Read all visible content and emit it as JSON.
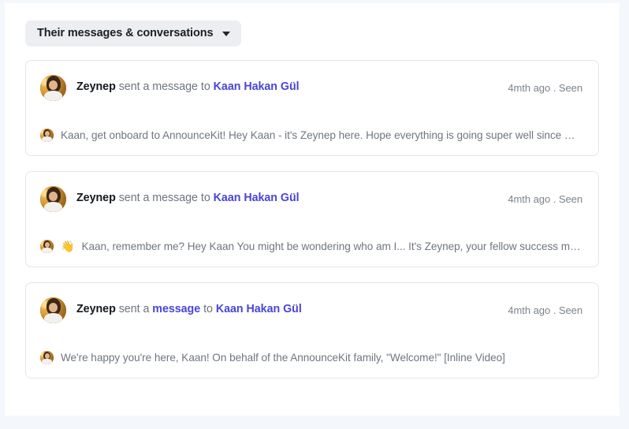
{
  "filter": {
    "label": "Their messages & conversations",
    "caret_icon": "chevron-down-icon"
  },
  "colors": {
    "page_background": "#f4f7fb",
    "panel_background": "#ffffff",
    "card_border": "#e2e5ea",
    "link": "#4a45d8",
    "muted_text": "#6d7480",
    "strong_text": "#14181d",
    "filter_button_background": "#eceef1"
  },
  "cards": [
    {
      "avatar_icon": "user-avatar-zeynep",
      "actor": "Zeynep",
      "action_prefix": "sent a",
      "action_word": "message",
      "action_word_is_link": false,
      "to_word": "to",
      "recipient": "Kaan Hakan Gül",
      "meta": "4mth ago . Seen",
      "preview_avatar_icon": "user-avatar-zeynep-small",
      "preview_emoji": "",
      "preview_text": "Kaan, get onboard to AnnounceKit! Hey Kaan - it's Zeynep here. Hope everything is going super well since my…"
    },
    {
      "avatar_icon": "user-avatar-zeynep",
      "actor": "Zeynep",
      "action_prefix": "sent a",
      "action_word": "message",
      "action_word_is_link": false,
      "to_word": "to",
      "recipient": "Kaan Hakan Gül",
      "meta": "4mth ago . Seen",
      "preview_avatar_icon": "user-avatar-zeynep-small",
      "preview_emoji": "👋",
      "preview_text": "Kaan, remember me? Hey Kaan You might be wondering who am I... It's Zeynep, your fellow success mana…"
    },
    {
      "avatar_icon": "user-avatar-zeynep",
      "actor": "Zeynep",
      "action_prefix": "sent a",
      "action_word": "message",
      "action_word_is_link": true,
      "to_word": "to",
      "recipient": "Kaan Hakan Gül",
      "meta": "4mth ago . Seen",
      "preview_avatar_icon": "user-avatar-zeynep-small",
      "preview_emoji": "",
      "preview_text": "We're happy you're here, Kaan! On behalf of the AnnounceKit family, \"Welcome!\" [Inline Video]"
    }
  ]
}
